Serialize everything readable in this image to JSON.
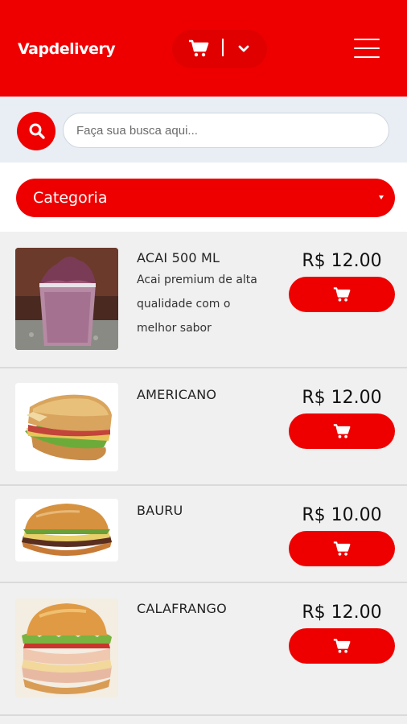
{
  "header": {
    "brand": "Vapdelivery",
    "cart_icon": "cart-icon",
    "dropdown_icon": "chevron-down-icon",
    "menu_icon": "hamburger-menu-icon",
    "bg_color": "#ef0000"
  },
  "search": {
    "icon": "search-icon",
    "placeholder": "Faça sua busca aqui..."
  },
  "category": {
    "label": "Categoria"
  },
  "products": [
    {
      "name": "ACAI 500 ML",
      "description": "Acai premium de alta qualidade com o melhor sabor",
      "price": "R$ 12.00",
      "image": "acai-cup"
    },
    {
      "name": "AMERICANO",
      "description": "",
      "price": "R$ 12.00",
      "image": "toasted-sandwich"
    },
    {
      "name": "BAURU",
      "description": "",
      "price": "R$ 10.00",
      "image": "burger"
    },
    {
      "name": "CALAFRANGO",
      "description": "",
      "price": "R$ 12.00",
      "image": "chicken-burger"
    }
  ]
}
